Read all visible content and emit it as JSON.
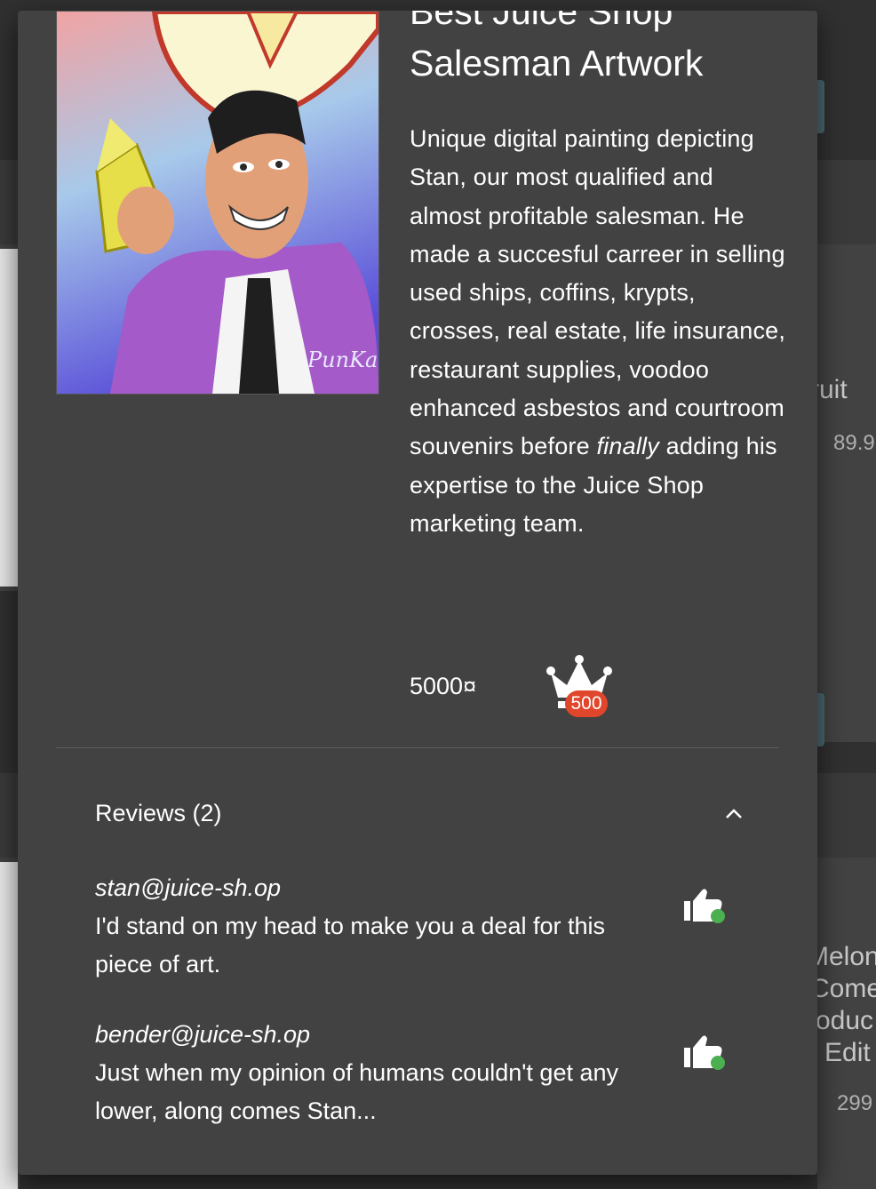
{
  "background": {
    "card1_name_fragment": "ruit",
    "card1_price_fragment": "89.9",
    "card2_name_lines": [
      "Melon",
      "Come",
      "oduc",
      "Edit"
    ],
    "card2_price_fragment": "299"
  },
  "product": {
    "title": "Best Juice Shop Salesman Artwork",
    "description_before": "Unique digital painting depicting Stan, our most qualified and almost profitable salesman. He made a succesful carreer in selling used ships, coffins, krypts, crosses, real estate, life insurance, restaurant supplies, voodoo enhanced asbestos and courtroom souvenirs before ",
    "description_emphasis": "finally",
    "description_after": " adding his expertise to the Juice Shop marketing team.",
    "price": "5000¤",
    "badge_label": "500",
    "artwork_signature": "PunKat"
  },
  "reviews": {
    "header": "Reviews (2)",
    "items": [
      {
        "author": "stan@juice-sh.op",
        "message": "I'd stand on my head to make you a deal for this piece of art."
      },
      {
        "author": "bender@juice-sh.op",
        "message": "Just when my opinion of humans couldn't get any lower, along comes Stan..."
      }
    ]
  },
  "colors": {
    "dialog_bg": "#424242",
    "page_bg": "#303030",
    "badge_red": "#e0462b",
    "like_green": "#4caf50"
  }
}
